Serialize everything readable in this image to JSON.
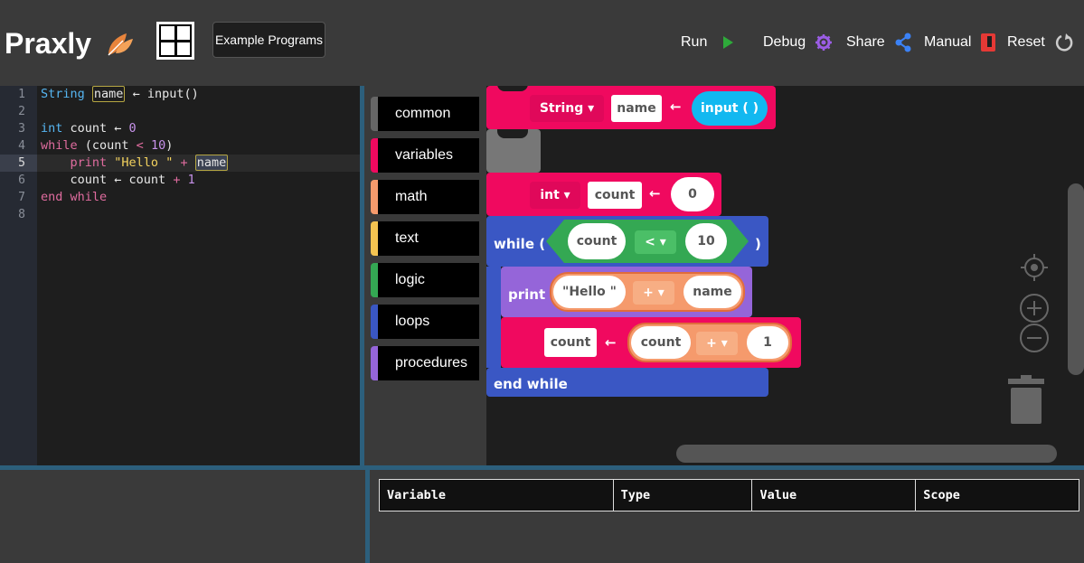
{
  "header": {
    "app_name": "Praxly",
    "logo_icon": "leaf-icon",
    "layout_icon": "grid-layout-icon",
    "examples_label": "Example Programs",
    "run_label": "Run",
    "debug_label": "Debug",
    "share_label": "Share",
    "manual_label": "Manual",
    "reset_label": "Reset",
    "colors": {
      "run": "#2eaa3a",
      "debug": "#9b5de5",
      "share": "#3b82f6",
      "manual": "#e53935"
    }
  },
  "editor": {
    "line_numbers": [
      "1",
      "2",
      "3",
      "4",
      "5",
      "6",
      "7",
      "8"
    ],
    "active_line": 5,
    "lines": [
      {
        "t1": "String",
        "t2": " ",
        "t3": "name",
        "t4": " ← input()"
      },
      {},
      {
        "t1": "int",
        "t2": " count ← ",
        "t3": "0"
      },
      {
        "t1": "while",
        "t2": " (count ",
        "t3": "<",
        "t4": " ",
        "t5": "10",
        "t6": ")"
      },
      {
        "t1": "    print",
        "t2": " ",
        "t3": "\"Hello \"",
        "t4": " ",
        "t5": "+",
        "t6": " ",
        "t7": "name"
      },
      {
        "t1": "    count ← count ",
        "t2": "+",
        "t3": " ",
        "t4": "1"
      },
      {
        "t1": "end",
        "t2": " ",
        "t3": "while"
      },
      {}
    ]
  },
  "toolbox": {
    "categories": [
      {
        "label": "common",
        "color": "#666666"
      },
      {
        "label": "variables",
        "color": "#f0095f"
      },
      {
        "label": "math",
        "color": "#f59a6c"
      },
      {
        "label": "text",
        "color": "#f5c451"
      },
      {
        "label": "logic",
        "color": "#34a853"
      },
      {
        "label": "loops",
        "color": "#3a57c4"
      },
      {
        "label": "procedures",
        "color": "#9565d9"
      }
    ]
  },
  "blocks": {
    "decl1": {
      "type": "String",
      "name": "name",
      "call": "input ( )"
    },
    "decl2": {
      "type": "int",
      "name": "count",
      "value": "0"
    },
    "while_open": "while (",
    "while_close": ")",
    "cond": {
      "left": "count",
      "op": "<",
      "right": "10"
    },
    "print_label": "print",
    "print_expr": {
      "left": "\"Hello \"",
      "op": "+",
      "right": "name"
    },
    "assign": {
      "target": "count",
      "left": "count",
      "op": "+",
      "right": "1"
    },
    "end_while": "end while"
  },
  "variables_table": {
    "headers": [
      "Variable",
      "Type",
      "Value",
      "Scope"
    ]
  }
}
